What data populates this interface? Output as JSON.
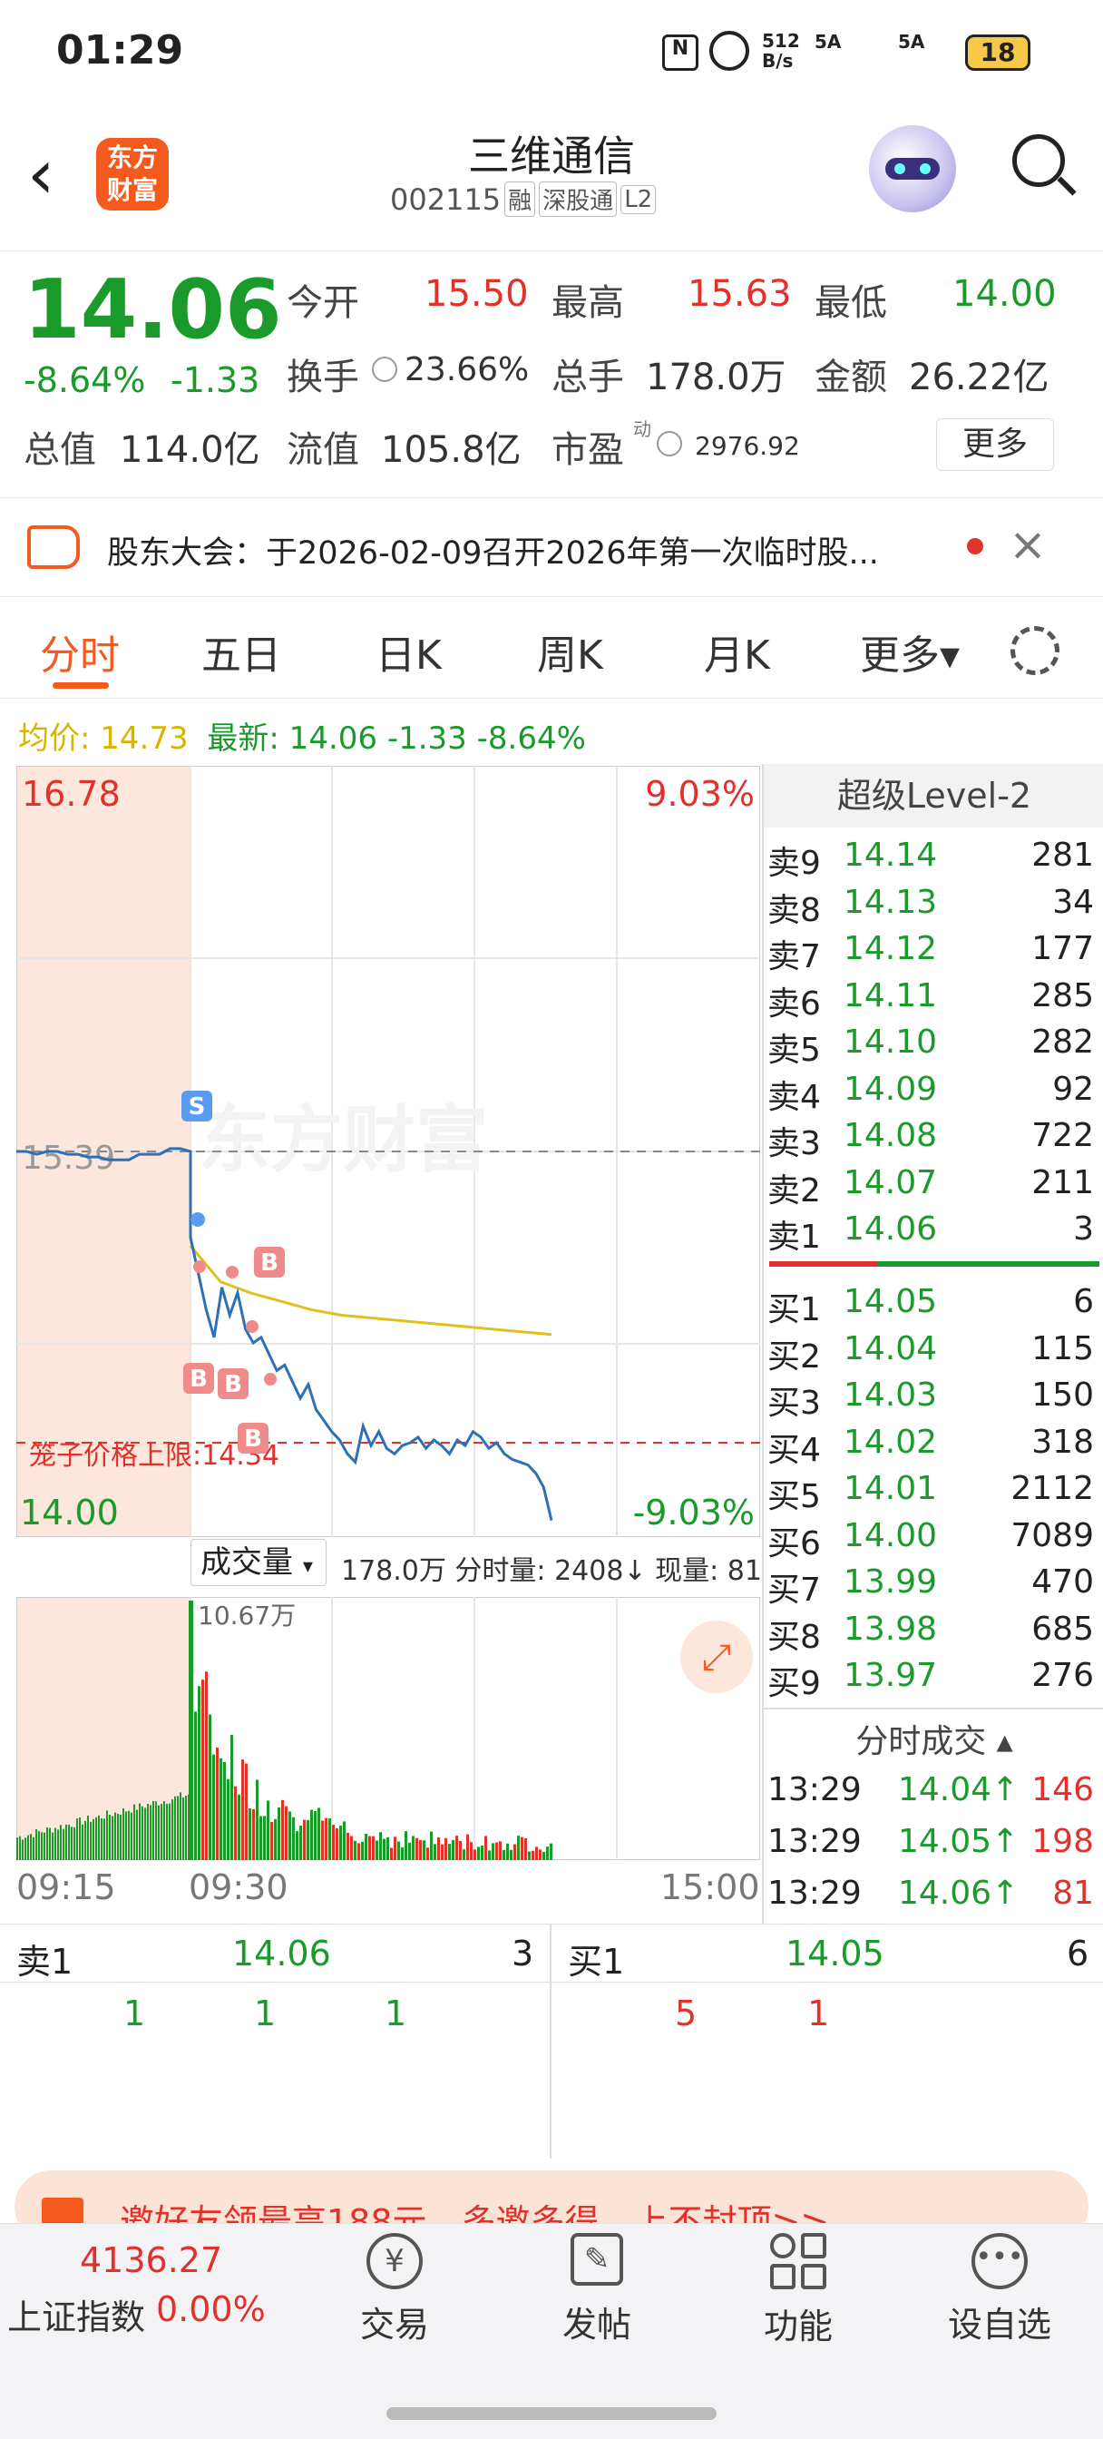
{
  "status": {
    "time": "01:29",
    "net_speed": "512 B/s",
    "sig1": "5A",
    "sig2": "5A",
    "battery": "18"
  },
  "header": {
    "title": "三维通信",
    "code": "002115",
    "tags": [
      "融",
      "深股通",
      "L2"
    ],
    "logo_line1": "东方",
    "logo_line2": "财富"
  },
  "quote": {
    "price": "14.06",
    "change_pct": "-8.64%",
    "change": "-1.33",
    "open_label": "今开",
    "open": "15.50",
    "high_label": "最高",
    "high": "15.63",
    "low_label": "最低",
    "low": "14.00",
    "turnover_label": "换手",
    "turnover": "23.66%",
    "volume_label": "总手",
    "volume": "178.0万",
    "amount_label": "金额",
    "amount": "26.22亿",
    "mcap_label": "总值",
    "mcap": "114.0亿",
    "float_label": "流值",
    "float_cap": "105.8亿",
    "pe_label": "市盈",
    "pe_sup": "动",
    "pe": "2976.92",
    "more_button": "更多"
  },
  "notice": {
    "text": "股东大会：于2026-02-09召开2026年第一次临时股..."
  },
  "tabs": [
    "分时",
    "五日",
    "日K",
    "周K",
    "月K",
    "更多▾"
  ],
  "chart_legend": {
    "avg_label": "均价: 14.73",
    "latest_label": "最新: 14.06 -1.33 -8.64%"
  },
  "chart_data": {
    "type": "line",
    "y_top": "16.78",
    "y_bottom": "14.00",
    "pct_top": "9.03%",
    "pct_bottom": "-9.03%",
    "prev_close": "15.39",
    "cage_label": "笼子价格上限:14.34",
    "watermark": "东方财富",
    "x_labels": [
      "09:15",
      "09:30",
      "15:00"
    ],
    "ylim": [
      14.0,
      16.78
    ],
    "price_series": [
      15.39,
      15.39,
      15.38,
      15.39,
      15.39,
      15.38,
      15.38,
      15.37,
      15.37,
      15.36,
      15.36,
      15.36,
      15.38,
      15.38,
      15.38,
      15.4,
      15.4,
      15.39,
      15.08,
      14.95,
      14.82,
      14.72,
      14.9,
      14.8,
      14.88,
      14.75,
      14.7,
      14.72,
      14.66,
      14.6,
      14.62,
      14.56,
      14.5,
      14.55,
      14.46,
      14.42,
      14.38,
      14.35,
      14.3,
      14.27,
      14.4,
      14.33,
      14.38,
      14.32,
      14.3,
      14.33,
      14.34,
      14.36,
      14.32,
      14.35,
      14.33,
      14.3,
      14.35,
      14.33,
      14.38,
      14.36,
      14.32,
      14.34,
      14.3,
      14.28,
      14.27,
      14.26,
      14.23,
      14.18,
      14.06
    ],
    "avg_series": [
      15.05,
      14.92,
      14.88,
      14.85,
      14.82,
      14.8,
      14.79,
      14.78,
      14.77,
      14.76,
      14.75,
      14.74,
      14.73
    ],
    "markers": [
      "S",
      "B",
      "B",
      "B",
      "B"
    ],
    "volume_title": "成交量",
    "volume_stats": "178.0万 分时量: 2408↓ 现量: 81",
    "volume_max": "10.67万"
  },
  "orderbook": {
    "title": "超级Level-2",
    "asks": [
      {
        "label": "卖9",
        "price": "14.14",
        "vol": "281"
      },
      {
        "label": "卖8",
        "price": "14.13",
        "vol": "34"
      },
      {
        "label": "卖7",
        "price": "14.12",
        "vol": "177"
      },
      {
        "label": "卖6",
        "price": "14.11",
        "vol": "285"
      },
      {
        "label": "卖5",
        "price": "14.10",
        "vol": "282"
      },
      {
        "label": "卖4",
        "price": "14.09",
        "vol": "92"
      },
      {
        "label": "卖3",
        "price": "14.08",
        "vol": "722"
      },
      {
        "label": "卖2",
        "price": "14.07",
        "vol": "211"
      },
      {
        "label": "卖1",
        "price": "14.06",
        "vol": "3"
      }
    ],
    "bids": [
      {
        "label": "买1",
        "price": "14.05",
        "vol": "6"
      },
      {
        "label": "买2",
        "price": "14.04",
        "vol": "115"
      },
      {
        "label": "买3",
        "price": "14.03",
        "vol": "150"
      },
      {
        "label": "买4",
        "price": "14.02",
        "vol": "318"
      },
      {
        "label": "买5",
        "price": "14.01",
        "vol": "2112"
      },
      {
        "label": "买6",
        "price": "14.00",
        "vol": "7089"
      },
      {
        "label": "买7",
        "price": "13.99",
        "vol": "470"
      },
      {
        "label": "买8",
        "price": "13.98",
        "vol": "685"
      },
      {
        "label": "买9",
        "price": "13.97",
        "vol": "276"
      }
    ],
    "trades_title": "分时成交 ▴",
    "trades": [
      {
        "time": "13:29",
        "price": "14.04↑",
        "vol": "146"
      },
      {
        "time": "13:29",
        "price": "14.05↑",
        "vol": "198"
      },
      {
        "time": "13:29",
        "price": "14.06↑",
        "vol": "81"
      }
    ]
  },
  "queue": {
    "ask_label": "卖1",
    "ask_price": "14.06",
    "ask_vol": "3",
    "ask_orders": [
      "1",
      "1",
      "1"
    ],
    "bid_label": "买1",
    "bid_price": "14.05",
    "bid_vol": "6",
    "bid_orders": [
      "5",
      "1"
    ]
  },
  "banner": {
    "text": "邀好友领最高188元，多邀多得，上不封顶>>"
  },
  "bottom_nav": {
    "index_value": "4136.27",
    "index_name": "上证指数",
    "index_change": "0.00%",
    "items": [
      "交易",
      "发帖",
      "功能",
      "设自选"
    ]
  }
}
